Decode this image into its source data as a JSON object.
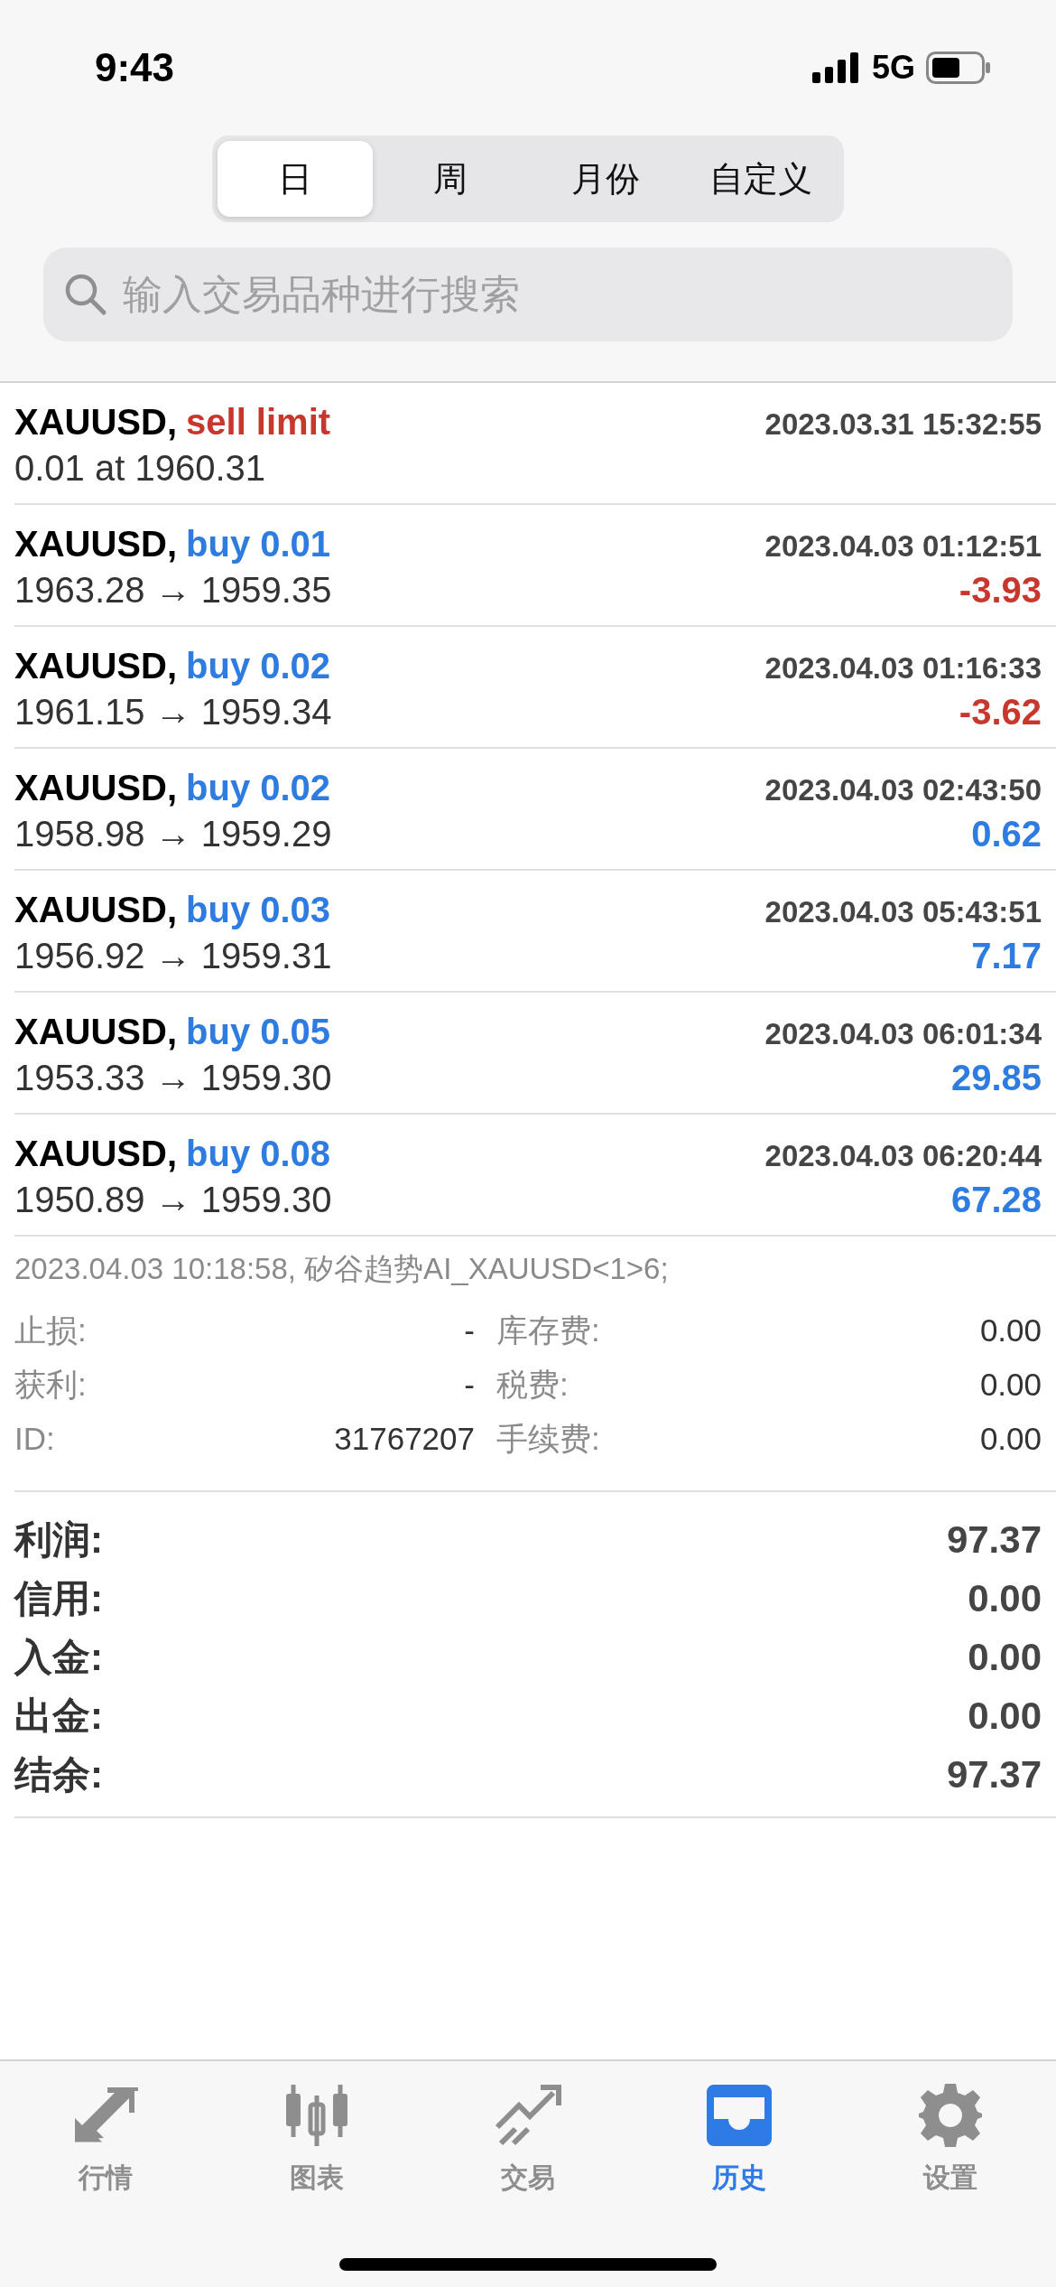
{
  "status_bar": {
    "time": "9:43",
    "network": "5G"
  },
  "tabs": [
    {
      "label": "日",
      "selected": true
    },
    {
      "label": "周",
      "selected": false
    },
    {
      "label": "月份",
      "selected": false
    },
    {
      "label": "自定义",
      "selected": false
    }
  ],
  "search": {
    "placeholder": "输入交易品种进行搜索"
  },
  "trades": [
    {
      "symbol": "XAUUSD,",
      "kind": "sell",
      "action": "sell limit",
      "time": "2023.03.31 15:32:55",
      "prices": "0.01 at 1960.31"
    },
    {
      "symbol": "XAUUSD,",
      "kind": "buy",
      "action": "buy 0.01",
      "time": "2023.04.03 01:12:51",
      "prices": "1963.28 → 1959.35",
      "profit": "-3.93",
      "negative": true
    },
    {
      "symbol": "XAUUSD,",
      "kind": "buy",
      "action": "buy 0.02",
      "time": "2023.04.03 01:16:33",
      "prices": "1961.15 → 1959.34",
      "profit": "-3.62",
      "negative": true
    },
    {
      "symbol": "XAUUSD,",
      "kind": "buy",
      "action": "buy 0.02",
      "time": "2023.04.03 02:43:50",
      "prices": "1958.98 → 1959.29",
      "profit": "0.62",
      "negative": false
    },
    {
      "symbol": "XAUUSD,",
      "kind": "buy",
      "action": "buy 0.03",
      "time": "2023.04.03 05:43:51",
      "prices": "1956.92 → 1959.31",
      "profit": "7.17",
      "negative": false
    },
    {
      "symbol": "XAUUSD,",
      "kind": "buy",
      "action": "buy 0.05",
      "time": "2023.04.03 06:01:34",
      "prices": "1953.33 → 1959.30",
      "profit": "29.85",
      "negative": false
    },
    {
      "symbol": "XAUUSD,",
      "kind": "buy",
      "action": "buy 0.08",
      "time": "2023.04.03 06:20:44",
      "prices": "1950.89 → 1959.30",
      "profit": "67.28",
      "negative": false
    }
  ],
  "details": {
    "comment": "2023.04.03 10:18:58, 矽谷趋势AI_XAUUSD<1>6;",
    "fields": [
      {
        "label": "止损:",
        "value": "-",
        "label2": "库存费:",
        "value2": "0.00"
      },
      {
        "label": "获利:",
        "value": "-",
        "label2": "税费:",
        "value2": "0.00"
      },
      {
        "label": "ID:",
        "value": "31767207",
        "label2": "手续费:",
        "value2": "0.00"
      }
    ]
  },
  "summary": [
    {
      "label": "利润:",
      "value": "97.37"
    },
    {
      "label": "信用:",
      "value": "0.00"
    },
    {
      "label": "入金:",
      "value": "0.00"
    },
    {
      "label": "出金:",
      "value": "0.00"
    },
    {
      "label": "结余:",
      "value": "97.37"
    }
  ],
  "tab_bar": [
    {
      "label": "行情",
      "selected": false
    },
    {
      "label": "图表",
      "selected": false
    },
    {
      "label": "交易",
      "selected": false
    },
    {
      "label": "历史",
      "selected": true
    },
    {
      "label": "设置",
      "selected": false
    }
  ]
}
